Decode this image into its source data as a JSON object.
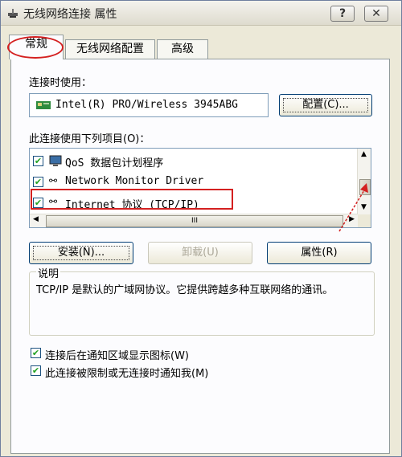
{
  "window": {
    "title": "无线网络连接 属性",
    "help_button": "?",
    "close_button": "✕"
  },
  "tabs": [
    {
      "label": "常规"
    },
    {
      "label": "无线网络配置"
    },
    {
      "label": "高级"
    }
  ],
  "general": {
    "connect_using_label": "连接时使用：",
    "adapter_name": "Intel(R) PRO/Wireless 3945ABG",
    "configure_button": "配置(C)...",
    "items_label": "此连接使用下列项目(O)：",
    "items": [
      {
        "label": "QoS 数据包计划程序",
        "checked": true
      },
      {
        "label": "Network Monitor Driver",
        "checked": true
      },
      {
        "label": "Internet 协议 (TCP/IP)",
        "checked": true
      }
    ],
    "hscroll_thumb": "III",
    "install_button": "安装(N)...",
    "uninstall_button": "卸载(U)",
    "properties_button": "属性(R)",
    "description_title": "说明",
    "description_text": "TCP/IP 是默认的广域网协议。它提供跨越多种互联网络的通讯。",
    "show_icon_label": "连接后在通知区域显示图标(W)",
    "show_icon_checked": true,
    "notify_label": "此连接被限制或无连接时通知我(M)",
    "notify_checked": true
  },
  "colors": {
    "annotation_red": "#d42020"
  }
}
